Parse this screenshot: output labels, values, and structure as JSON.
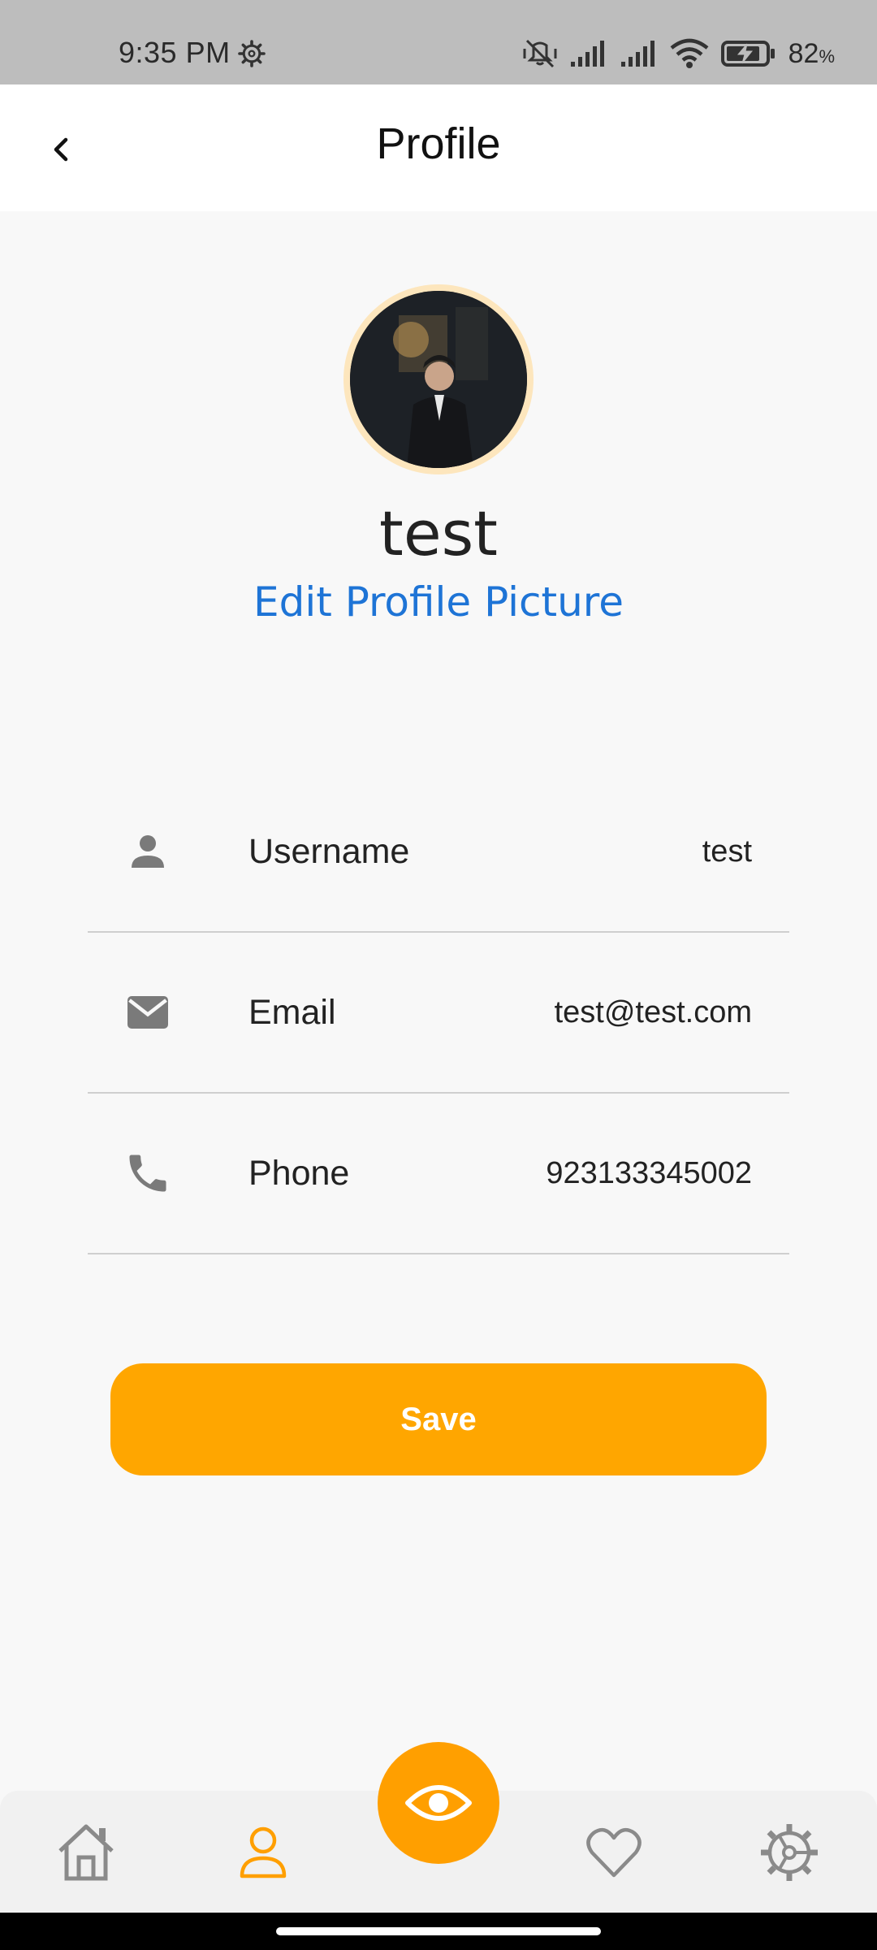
{
  "status_bar": {
    "time": "9:35 PM",
    "battery": "82",
    "battery_unit": "%",
    "icons": [
      "settings-gear-icon",
      "mute-vibrate-icon",
      "signal-icon",
      "signal-icon",
      "wifi-icon",
      "battery-charging-icon"
    ]
  },
  "app_bar": {
    "title": "Profile",
    "back_icon": "chevron-left-icon"
  },
  "profile": {
    "name": "test",
    "edit_picture_label": "Edit Profile Picture"
  },
  "fields": [
    {
      "icon": "person-icon",
      "label": "Username",
      "value": "test"
    },
    {
      "icon": "mail-icon",
      "label": "Email",
      "value": "test@test.com"
    },
    {
      "icon": "phone-icon",
      "label": "Phone",
      "value": "923133345002"
    }
  ],
  "actions": {
    "save_label": "Save"
  },
  "bottom_nav": {
    "items": [
      "home-icon",
      "profile-icon",
      "favorites-heart-icon",
      "settings-gear-icon"
    ],
    "active": "profile-icon",
    "fab_icon": "eye-icon"
  },
  "colors": {
    "accent": "#ffa600",
    "link": "#1e74d6",
    "avatar_ring": "#fde6bd",
    "nav_inactive": "#8a8a8a",
    "nav_active": "#ff9f00"
  }
}
